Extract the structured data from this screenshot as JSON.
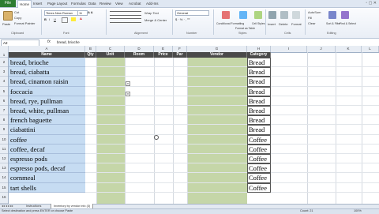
{
  "ribbon": {
    "file_tab": "File",
    "tabs": [
      "Home",
      "Insert",
      "Page Layout",
      "Formulas",
      "Data",
      "Review",
      "View",
      "Acrobat",
      "Add-Ins"
    ],
    "clipboard": {
      "paste": "Paste",
      "cut": "Cut",
      "copy": "Copy",
      "format_painter": "Format Painter",
      "group": "Clipboard"
    },
    "font": {
      "name": "Times New Roman",
      "size": "11",
      "group": "Font"
    },
    "alignment": {
      "wrap": "Wrap Text",
      "merge": "Merge & Center",
      "group": "Alignment"
    },
    "number": {
      "format": "General",
      "group": "Number"
    },
    "styles": {
      "conditional": "Conditional Formatting",
      "format_table": "Format as Table",
      "cell_styles": "Cell Styles",
      "group": "Styles"
    },
    "cells": {
      "insert": "Insert",
      "delete": "Delete",
      "format": "Format",
      "group": "Cells"
    },
    "editing": {
      "autosum": "AutoSum",
      "fill": "Fill",
      "clear": "Clear",
      "sort": "Sort & Filter",
      "find": "Find & Select",
      "group": "Editing"
    }
  },
  "formula_bar": {
    "name_box": "A2",
    "fx": "fx",
    "content": "bread, brioche"
  },
  "columns": [
    "A",
    "B",
    "C",
    "D",
    "E",
    "F",
    "G",
    "H",
    "I",
    "J",
    "K",
    "L"
  ],
  "headers": {
    "name": "Name",
    "qty": "Qty",
    "unit": "Unit",
    "room": "Room",
    "price": "Price",
    "par": "Par",
    "vendor": "Vendor",
    "category": "Category"
  },
  "row_numbers": [
    "1",
    "2",
    "3",
    "4",
    "5",
    "6",
    "7",
    "8",
    "9",
    "10",
    "11",
    "12",
    "13",
    "14",
    "15",
    "16"
  ],
  "rows": [
    {
      "name": "bread, brioche",
      "category": "Bread"
    },
    {
      "name": "bread, ciabatta",
      "category": "Bread"
    },
    {
      "name": "bread, cinamon raisin",
      "category": "Bread"
    },
    {
      "name": "foccacia",
      "category": "Bread"
    },
    {
      "name": "bread, rye, pullman",
      "category": "Bread"
    },
    {
      "name": "bread, white, pullman",
      "category": "Bread"
    },
    {
      "name": "french baguette",
      "category": "Bread"
    },
    {
      "name": "ciabattini",
      "category": "Bread"
    },
    {
      "name": "coffee",
      "category": "Coffee"
    },
    {
      "name": "coffee, decaf",
      "category": "Coffee"
    },
    {
      "name": "espresso pods",
      "category": "Coffee"
    },
    {
      "name": "espresso pods, decaf",
      "category": "Coffee"
    },
    {
      "name": "cornmeal",
      "category": "Coffee"
    },
    {
      "name": "tart shells",
      "category": "Coffee"
    }
  ],
  "sheet_tabs": [
    "Instructions",
    "Inventory by vendor info (3)"
  ],
  "status": {
    "left": "Select destination and press ENTER or choose Paste",
    "count": "Count: 21",
    "zoom": "100%"
  },
  "colors": {
    "name_fill": "#c6dcf2",
    "band_fill": "#c5d6a8",
    "header_fill": "#4a4a4a",
    "excel_green": "#2e7d32"
  }
}
